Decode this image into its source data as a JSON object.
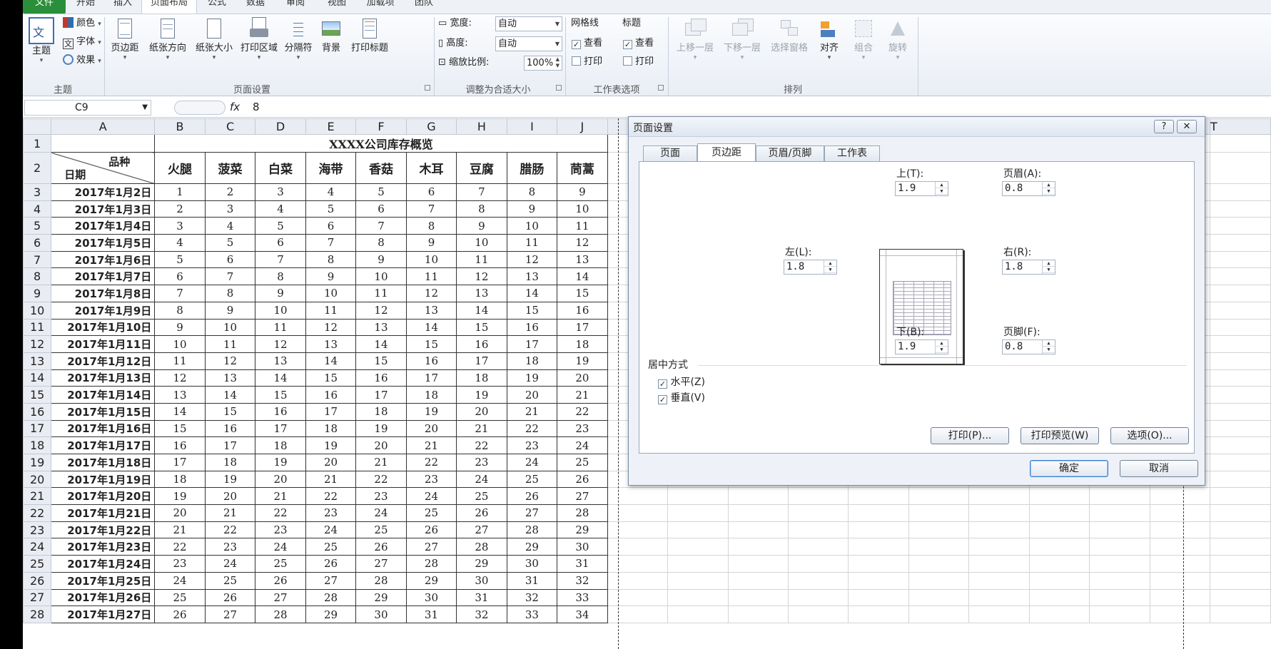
{
  "tabs": {
    "file": "文件",
    "home": "开始",
    "insert": "插入",
    "pagelayout": "页面布局",
    "formulas": "公式",
    "data": "数据",
    "review": "审阅",
    "view": "视图",
    "addins": "加载项",
    "team": "团队"
  },
  "ribbon": {
    "themes": {
      "theme_label": "主题",
      "colors": "颜色",
      "fonts": "字体",
      "effects": "效果",
      "group": "主题"
    },
    "page_setup": {
      "margins": "页边距",
      "orientation": "纸张方向",
      "size": "纸张大小",
      "print_area": "打印区域",
      "breaks": "分隔符",
      "background": "背景",
      "print_titles": "打印标题",
      "group": "页面设置"
    },
    "scale": {
      "width_label": "宽度:",
      "width_value": "自动",
      "height_label": "高度:",
      "height_value": "自动",
      "scale_label": "缩放比例:",
      "scale_value": "100%",
      "group": "调整为合适大小"
    },
    "sheet_options": {
      "gridlines": "网格线",
      "headings": "标题",
      "view": "查看",
      "print": "打印",
      "group": "工作表选项"
    },
    "arrange": {
      "bring_forward": "上移一层",
      "send_backward": "下移一层",
      "selection_pane": "选择窗格",
      "align": "对齐",
      "group_btn": "组合",
      "rotate": "旋转",
      "group": "排列"
    }
  },
  "formula_bar": {
    "name_box": "C9",
    "fx": "fx",
    "value": "8"
  },
  "sheet": {
    "columns": [
      "A",
      "B",
      "C",
      "D",
      "E",
      "F",
      "G",
      "H",
      "I",
      "J"
    ],
    "title": "XXXX公司库存概览",
    "corner_top": "品种",
    "corner_bottom": "日期",
    "headers": [
      "火腿",
      "菠菜",
      "白菜",
      "海带",
      "香菇",
      "木耳",
      "豆腐",
      "腊肠",
      "茼蒿"
    ],
    "rows": [
      [
        "2017年1月2日",
        1,
        2,
        3,
        4,
        5,
        6,
        7,
        8,
        9
      ],
      [
        "2017年1月3日",
        2,
        3,
        4,
        5,
        6,
        7,
        8,
        9,
        10
      ],
      [
        "2017年1月4日",
        3,
        4,
        5,
        6,
        7,
        8,
        9,
        10,
        11
      ],
      [
        "2017年1月5日",
        4,
        5,
        6,
        7,
        8,
        9,
        10,
        11,
        12
      ],
      [
        "2017年1月6日",
        5,
        6,
        7,
        8,
        9,
        10,
        11,
        12,
        13
      ],
      [
        "2017年1月7日",
        6,
        7,
        8,
        9,
        10,
        11,
        12,
        13,
        14
      ],
      [
        "2017年1月8日",
        7,
        8,
        9,
        10,
        11,
        12,
        13,
        14,
        15
      ],
      [
        "2017年1月9日",
        8,
        9,
        10,
        11,
        12,
        13,
        14,
        15,
        16
      ],
      [
        "2017年1月10日",
        9,
        10,
        11,
        12,
        13,
        14,
        15,
        16,
        17
      ],
      [
        "2017年1月11日",
        10,
        11,
        12,
        13,
        14,
        15,
        16,
        17,
        18
      ],
      [
        "2017年1月12日",
        11,
        12,
        13,
        14,
        15,
        16,
        17,
        18,
        19
      ],
      [
        "2017年1月13日",
        12,
        13,
        14,
        15,
        16,
        17,
        18,
        19,
        20
      ],
      [
        "2017年1月14日",
        13,
        14,
        15,
        16,
        17,
        18,
        19,
        20,
        21
      ],
      [
        "2017年1月15日",
        14,
        15,
        16,
        17,
        18,
        19,
        20,
        21,
        22
      ],
      [
        "2017年1月16日",
        15,
        16,
        17,
        18,
        19,
        20,
        21,
        22,
        23
      ],
      [
        "2017年1月17日",
        16,
        17,
        18,
        19,
        20,
        21,
        22,
        23,
        24
      ],
      [
        "2017年1月18日",
        17,
        18,
        19,
        20,
        21,
        22,
        23,
        24,
        25
      ],
      [
        "2017年1月19日",
        18,
        19,
        20,
        21,
        22,
        23,
        24,
        25,
        26
      ],
      [
        "2017年1月20日",
        19,
        20,
        21,
        22,
        23,
        24,
        25,
        26,
        27
      ],
      [
        "2017年1月21日",
        20,
        21,
        22,
        23,
        24,
        25,
        26,
        27,
        28
      ],
      [
        "2017年1月22日",
        21,
        22,
        23,
        24,
        25,
        26,
        27,
        28,
        29
      ],
      [
        "2017年1月23日",
        22,
        23,
        24,
        25,
        26,
        27,
        28,
        29,
        30
      ],
      [
        "2017年1月24日",
        23,
        24,
        25,
        26,
        27,
        28,
        29,
        30,
        31
      ],
      [
        "2017年1月25日",
        24,
        25,
        26,
        27,
        28,
        29,
        30,
        31,
        32
      ],
      [
        "2017年1月26日",
        25,
        26,
        27,
        28,
        29,
        30,
        31,
        32,
        33
      ],
      [
        "2017年1月27日",
        26,
        27,
        28,
        29,
        30,
        31,
        32,
        33,
        34
      ]
    ],
    "partial_col_label": "T"
  },
  "dialog": {
    "title": "页面设置",
    "help": "?",
    "close": "✕",
    "tabs": [
      "页面",
      "页边距",
      "页眉/页脚",
      "工作表"
    ],
    "top_label": "上(T):",
    "top_value": "1.9",
    "header_label": "页眉(A):",
    "header_value": "0.8",
    "left_label": "左(L):",
    "left_value": "1.8",
    "right_label": "右(R):",
    "right_value": "1.8",
    "bottom_label": "下(B):",
    "bottom_value": "1.9",
    "footer_label": "页脚(F):",
    "footer_value": "0.8",
    "center_label": "居中方式",
    "horizontal": "水平(Z)",
    "vertical": "垂直(V)",
    "print_btn": "打印(P)...",
    "preview_btn": "打印预览(W)",
    "options_btn": "选项(O)...",
    "ok_btn": "确定",
    "cancel_btn": "取消"
  }
}
